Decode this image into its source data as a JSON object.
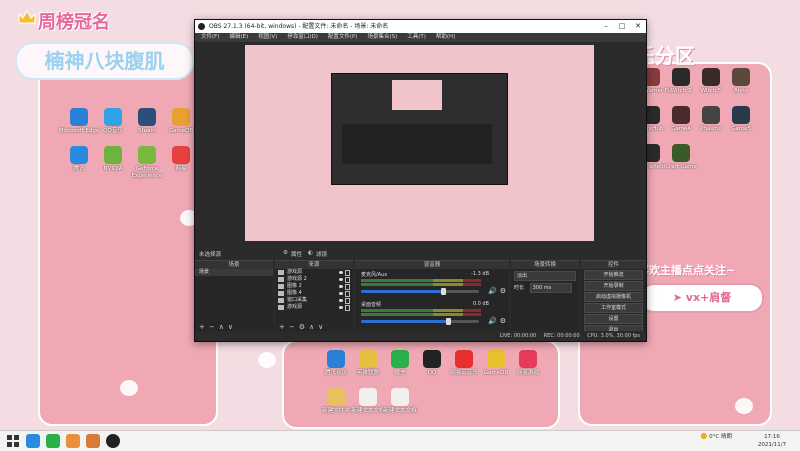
{
  "desktop": {
    "banner_top": "周榜冠名",
    "banner_name": "楠神八块腹肌",
    "right_banner": "乐分区",
    "notice": "喜欢主播点点关注~",
    "vx_text": "vx+肩督",
    "left_icons": [
      {
        "label": "Microsoft Edge",
        "color": "#2a7fd6"
      },
      {
        "label": "QQ音乐",
        "color": "#2fa3e6"
      },
      {
        "label": "Steam",
        "color": "#2b4f7a"
      },
      {
        "label": "GameOB",
        "color": "#e8a030"
      },
      {
        "label": "腾讯",
        "color": "#2a8adf"
      },
      {
        "label": "NVIDIA",
        "color": "#6db33f"
      },
      {
        "label": "GeForce Experience",
        "color": "#78b83c"
      },
      {
        "label": "网易",
        "color": "#e84040"
      }
    ],
    "right_icons": [
      {
        "label": "Game",
        "color": "#333"
      },
      {
        "label": "大话 Warner Fu",
        "color": "#8a3a3a"
      },
      {
        "label": "Witch 3",
        "color": "#2a2a2a"
      },
      {
        "label": "Witch 5",
        "color": "#3a2a2a"
      },
      {
        "label": "Anno",
        "color": "#5a4a3a"
      },
      {
        "label": "Sekiro",
        "color": "#333"
      },
      {
        "label": "LibreHub",
        "color": "#2a2a2a"
      },
      {
        "label": "Game4",
        "color": "#4a2a2a"
      },
      {
        "label": "Phasmo",
        "color": "#444"
      },
      {
        "label": "Game5",
        "color": "#2a3a4a"
      },
      {
        "label": "FIFA 22",
        "color": "#1a3a5a"
      },
      {
        "label": "Battlefield",
        "color": "#2a2a2a"
      },
      {
        "label": "Craft Game",
        "color": "#3a5a2a"
      }
    ],
    "bottom_icons": [
      {
        "label": "腾讯会议",
        "color": "#2a7fd6"
      },
      {
        "label": "英雄联盟",
        "color": "#e8c040"
      },
      {
        "label": "微信",
        "color": "#2ab04a"
      },
      {
        "label": "QQ",
        "color": "#222"
      },
      {
        "label": "网易云音乐",
        "color": "#e83030"
      },
      {
        "label": "GameDB",
        "color": "#e8c030"
      },
      {
        "label": "网易游戏",
        "color": "#e83a5a"
      }
    ],
    "bottom_files": [
      {
        "label": "新建文件夹",
        "color": "#e8c060"
      },
      {
        "label": "新建文本文档",
        "color": "#f0f0f0"
      },
      {
        "label": "新建文本文档",
        "color": "#f0f0f0"
      }
    ]
  },
  "obs": {
    "title": "OBS 27.1.3 (64-bit, windows) - 配置文件: 未命名 - 场景: 未命名",
    "menu": [
      "文件(F)",
      "编辑(E)",
      "视图(V)",
      "停靠窗口(D)",
      "配置文件(P)",
      "场景集合(S)",
      "工具(T)",
      "帮助(H)"
    ],
    "tabs": {
      "filters": "滤镜",
      "properties": "属性"
    },
    "scene_header": "场景",
    "scene_item": "场景",
    "sources_header": "来源",
    "sources": [
      "游戏源",
      "游戏源 2",
      "图像 2",
      "图像 4",
      "窗口采集",
      "游戏源"
    ],
    "mixer_header": "混音器",
    "mixer": [
      {
        "name": "麦克风/Aux",
        "db": "-1.3 dB",
        "level": 0.68
      },
      {
        "name": "桌面音频",
        "db": "0.0 dB",
        "level": 0.72
      }
    ],
    "transition_header": "场景转换",
    "transition_value": "淡出",
    "duration_label": "时长",
    "duration_value": "300 ms",
    "controls_header": "控件",
    "controls": [
      "开始推流",
      "开始录制",
      "启动虚拟摄像机",
      "工作室模式",
      "设置",
      "退出"
    ],
    "status": {
      "live": "LIVE: 00:00:00",
      "rec": "REC: 00:00:00",
      "cpu": "CPU: 3.0%, 30.00 fps"
    },
    "selected_source": "未选择源"
  },
  "taskbar": {
    "weather": "0°C 晴朗",
    "time": "17:16",
    "date": "2021/11/7"
  }
}
